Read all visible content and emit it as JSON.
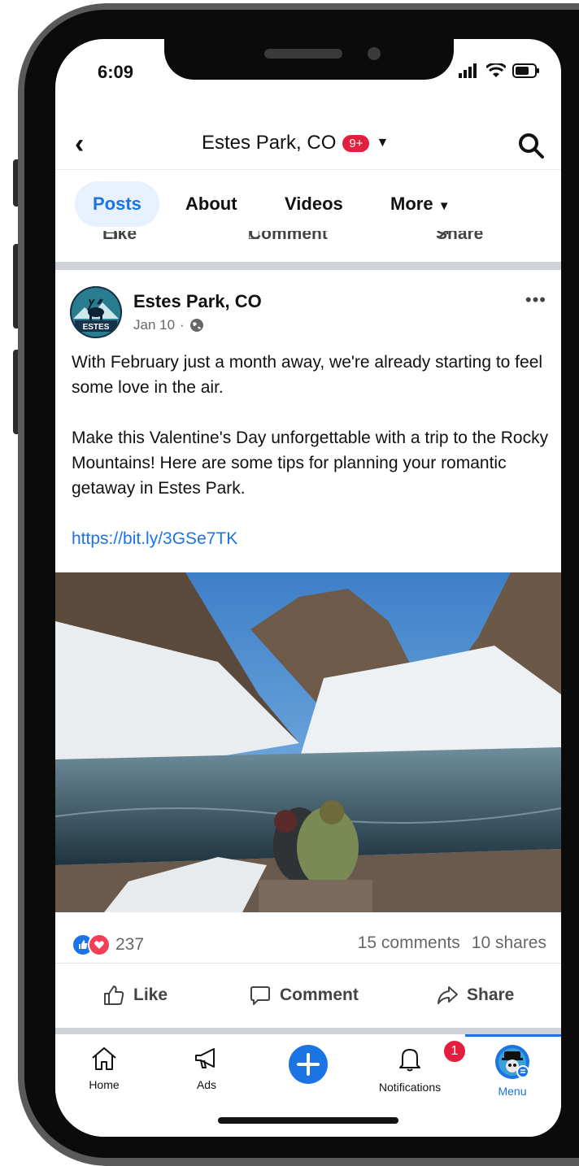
{
  "status_bar": {
    "time": "6:09"
  },
  "header": {
    "title": "Estes Park, CO",
    "badge": "9+"
  },
  "tabs": [
    {
      "label": "Posts"
    },
    {
      "label": "About"
    },
    {
      "label": "Videos"
    },
    {
      "label": "More"
    }
  ],
  "previous_post_actions": {
    "like": "Like",
    "comment": "Comment",
    "share": "Share"
  },
  "post": {
    "author": "Estes Park, CO",
    "logo_text": "ESTES",
    "date": "Jan 10",
    "separator": "·",
    "paragraph1": "With February just a month away, we're already starting to feel some love in the air.",
    "paragraph2": "Make this Valentine's Day unforgettable with a trip to the Rocky Mountains! Here are some tips for planning your romantic getaway in Estes Park.",
    "link": "https://bit.ly/3GSe7TK",
    "reactions_count": "237",
    "comments": "15 comments",
    "shares": "10 shares",
    "actions": {
      "like": "Like",
      "comment": "Comment",
      "share": "Share"
    }
  },
  "tabbar": {
    "home": "Home",
    "ads": "Ads",
    "notifications": "Notifications",
    "notifications_count": "1",
    "menu": "Menu"
  },
  "colors": {
    "accent": "#1b74e4",
    "badge": "#e41e3f",
    "love": "#f33e58"
  }
}
